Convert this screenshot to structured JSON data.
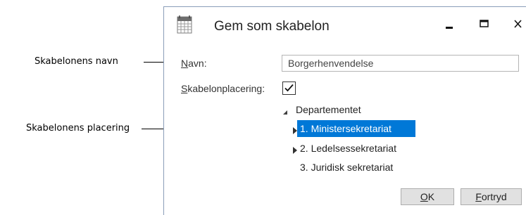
{
  "annotations": {
    "name_callout": "Skabelonens navn",
    "placement_callout": "Skabelonens placering"
  },
  "dialog": {
    "title": "Gem som skabelon",
    "app_icon": "calendar-grid-icon",
    "window_buttons": {
      "minimize_icon": "minimize-icon",
      "maximize_icon": "maximize-icon",
      "close_icon": "close-icon"
    },
    "name_field": {
      "label_accesskey": "N",
      "label_rest": "avn:",
      "value": "Borgerhenvendelse"
    },
    "placement_field": {
      "label_accesskey": "S",
      "label_rest": "kabelonplacering:",
      "checked": true
    },
    "tree": {
      "root": {
        "label": "Departementet",
        "expanded": true
      },
      "children": [
        {
          "label": "1. Ministersekretariat",
          "selected": true,
          "has_children": true
        },
        {
          "label": "2. Ledelsessekretariat",
          "selected": false,
          "has_children": true
        },
        {
          "label": "3. Juridisk sekretariat",
          "selected": false,
          "has_children": false
        }
      ]
    },
    "buttons": {
      "ok_accesskey": "O",
      "ok_rest": "K",
      "cancel_accesskey": "F",
      "cancel_rest": "ortryd"
    },
    "colors": {
      "selection": "#0078d7",
      "border": "#8a9db8"
    }
  }
}
